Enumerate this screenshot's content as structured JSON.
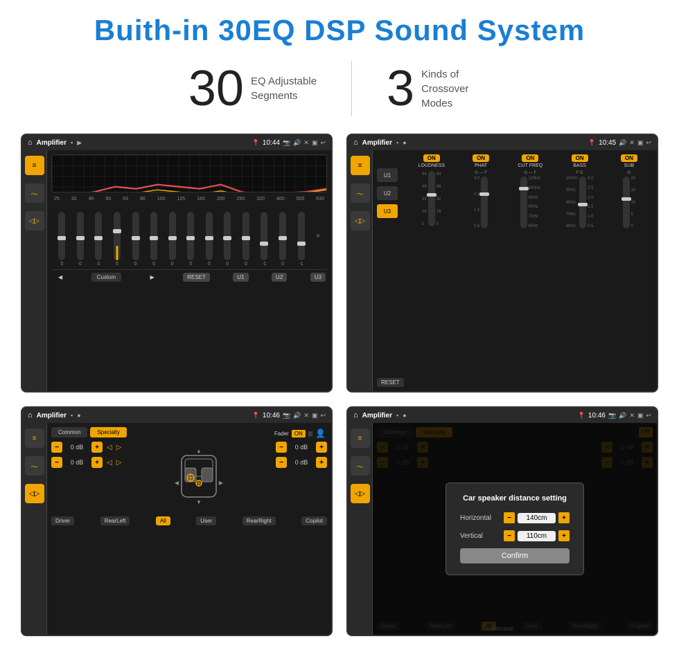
{
  "page": {
    "title": "Buith-in 30EQ DSP Sound System",
    "title_color": "#1a7fd4"
  },
  "stats": {
    "eq_number": "30",
    "eq_desc_line1": "EQ Adjustable",
    "eq_desc_line2": "Segments",
    "crossover_number": "3",
    "crossover_desc_line1": "Kinds of",
    "crossover_desc_line2": "Crossover Modes"
  },
  "screen1": {
    "title": "Amplifier",
    "time": "10:44",
    "freq_labels": [
      "25",
      "32",
      "40",
      "50",
      "63",
      "80",
      "100",
      "125",
      "160",
      "200",
      "250",
      "320",
      "400",
      "500",
      "630"
    ],
    "eq_values": [
      "0",
      "0",
      "0",
      "5",
      "0",
      "0",
      "0",
      "0",
      "0",
      "0",
      "0",
      "-1",
      "0",
      "-1"
    ],
    "controls": [
      "Custom",
      "RESET",
      "U1",
      "U2",
      "U3"
    ]
  },
  "screen2": {
    "title": "Amplifier",
    "time": "10:45",
    "presets": [
      "U1",
      "U2",
      "U3"
    ],
    "active_preset": "U3",
    "channels": [
      "LOUDNESS",
      "PHAT",
      "CUT FREQ",
      "BASS",
      "SUB"
    ],
    "channel_on": [
      "ON",
      "ON",
      "ON",
      "ON",
      "ON"
    ],
    "reset_label": "RESET"
  },
  "screen3": {
    "title": "Amplifier",
    "time": "10:46",
    "top_btns": [
      "Common",
      "Specialty"
    ],
    "active_btn": "Specialty",
    "fader_label": "Fader",
    "fader_on": "ON",
    "db_values": [
      "0 dB",
      "0 dB",
      "0 dB",
      "0 dB"
    ],
    "pos_btns": [
      "Driver",
      "RearLeft",
      "All",
      "User",
      "RearRight",
      "Copilot"
    ],
    "active_pos": "All"
  },
  "screen4": {
    "title": "Amplifier",
    "time": "10:46",
    "top_btns": [
      "Common",
      "Specialty"
    ],
    "modal": {
      "title": "Car speaker distance setting",
      "horizontal_label": "Horizontal",
      "horizontal_value": "140cm",
      "vertical_label": "Vertical",
      "vertical_value": "110cm",
      "confirm_label": "Confirm"
    },
    "db_values": [
      "0 dB",
      "0 dB"
    ],
    "pos_btns": [
      "Driver",
      "RearLeft",
      "All",
      "User",
      "RearRight",
      "Copilot"
    ]
  },
  "watermark": "Seicane"
}
